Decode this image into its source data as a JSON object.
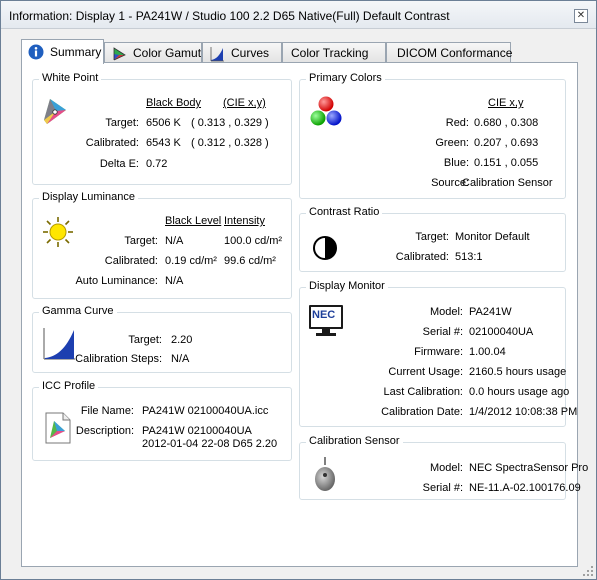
{
  "window": {
    "title": "Information: Display 1 - PA241W / Studio 100 2.2 D65 Native(Full) Default Contrast",
    "close_glyph": "✕"
  },
  "tabs": [
    {
      "label": "Summary",
      "icon": "info-icon",
      "active": true
    },
    {
      "label": "Color Gamut",
      "icon": "color-gamut-icon"
    },
    {
      "label": "Curves",
      "icon": "curves-icon"
    },
    {
      "label": "Color Tracking"
    },
    {
      "label": "DICOM Conformance"
    }
  ],
  "white_point": {
    "title": "White Point",
    "col_black_body": "Black Body",
    "col_cie": "(CIE x,y)",
    "target_label": "Target:",
    "target_kelvin": "6506 K",
    "target_xy": "( 0.313 , 0.329 )",
    "calibrated_label": "Calibrated:",
    "calibrated_kelvin": "6543 K",
    "calibrated_xy": "( 0.312 , 0.328 )",
    "delta_e_label": "Delta E:",
    "delta_e_value": "0.72"
  },
  "display_luminance": {
    "title": "Display Luminance",
    "col_black_level": "Black Level",
    "col_intensity": "Intensity",
    "target_label": "Target:",
    "target_black": "N/A",
    "target_intensity": "100.0 cd/m²",
    "calibrated_label": "Calibrated:",
    "calibrated_black": "0.19 cd/m²",
    "calibrated_intensity": "99.6 cd/m²",
    "auto_label": "Auto Luminance:",
    "auto_value": "N/A"
  },
  "gamma_curve": {
    "title": "Gamma Curve",
    "target_label": "Target:",
    "target_value": "2.20",
    "steps_label": "Calibration Steps:",
    "steps_value": "N/A"
  },
  "icc_profile": {
    "title": "ICC Profile",
    "file_label": "File Name:",
    "file_value": "PA241W 02100040UA.icc",
    "desc_label": "Description:",
    "desc_line1": "PA241W 02100040UA",
    "desc_line2": "2012-01-04 22-08 D65 2.20"
  },
  "primary_colors": {
    "title": "Primary Colors",
    "col_cie": "CIE x,y",
    "red_label": "Red:",
    "red_value": "0.680 , 0.308",
    "green_label": "Green:",
    "green_value": "0.207 , 0.693",
    "blue_label": "Blue:",
    "blue_value": "0.151 , 0.055",
    "source_label": "Source:",
    "source_value": "Calibration Sensor"
  },
  "contrast_ratio": {
    "title": "Contrast Ratio",
    "target_label": "Target:",
    "target_value": "Monitor Default",
    "calibrated_label": "Calibrated:",
    "calibrated_value": "513:1"
  },
  "display_monitor": {
    "title": "Display Monitor",
    "logo_text": "NEC",
    "model_label": "Model:",
    "model_value": "PA241W",
    "serial_label": "Serial #:",
    "serial_value": "02100040UA",
    "firmware_label": "Firmware:",
    "firmware_value": "1.00.04",
    "usage_label": "Current Usage:",
    "usage_value": "2160.5 hours usage",
    "last_cal_label": "Last Calibration:",
    "last_cal_value": "0.0 hours usage ago",
    "cal_date_label": "Calibration Date:",
    "cal_date_value": "1/4/2012 10:08:38 PM"
  },
  "calibration_sensor": {
    "title": "Calibration Sensor",
    "model_label": "Model:",
    "model_value": "NEC SpectraSensor Pro",
    "serial_label": "Serial #:",
    "serial_value": "NE-11.A-02.100176.09"
  }
}
